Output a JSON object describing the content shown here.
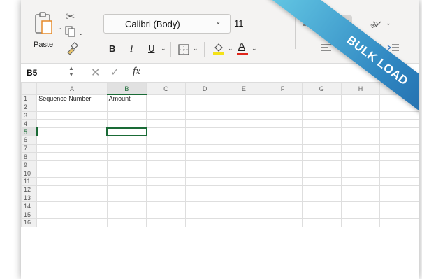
{
  "ribbon": {
    "paste_label": "Paste",
    "font_name": "Calibri (Body)",
    "font_size": "11",
    "bold": "B",
    "italic": "I",
    "underline": "U",
    "font_color_glyph": "A"
  },
  "formula_bar": {
    "name_box": "B5",
    "fx": "fx",
    "value": ""
  },
  "sheet": {
    "columns": [
      "A",
      "B",
      "C",
      "D",
      "E",
      "F",
      "G",
      "H",
      "I"
    ],
    "rows": [
      "1",
      "2",
      "3",
      "4",
      "5",
      "6",
      "7",
      "8",
      "9",
      "10",
      "11",
      "12",
      "13",
      "14",
      "15",
      "16"
    ],
    "cells": {
      "A1": "Sequence Number",
      "B1": "Amount"
    },
    "selected_cell": "B5"
  },
  "banner": {
    "text": "BULK LOAD"
  },
  "colors": {
    "excel_green": "#1a6b36",
    "banner_start": "#64c8e4",
    "banner_end": "#1a5a9c"
  },
  "icons": [
    "paste-icon",
    "cut-icon",
    "copy-icon",
    "format-painter-icon",
    "borders-icon",
    "fill-color-icon",
    "font-color-icon",
    "align-icon",
    "orientation-icon",
    "indent-icon"
  ]
}
